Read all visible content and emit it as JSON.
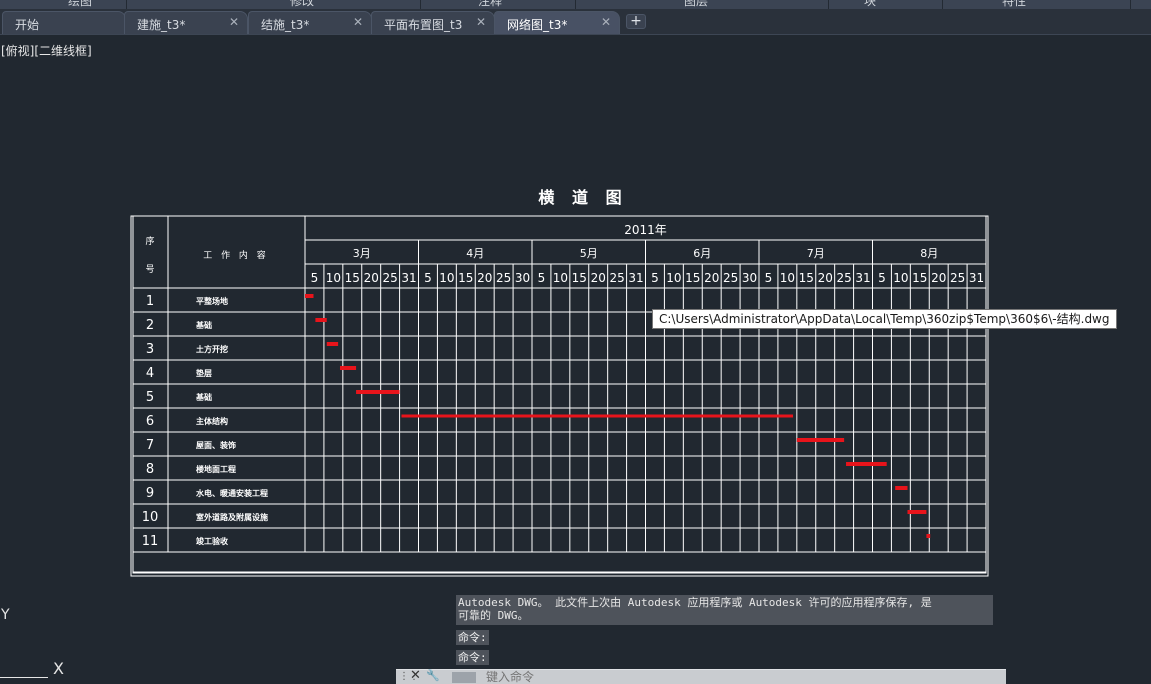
{
  "ribbon_panels": [
    "绘图",
    "修改",
    "注释",
    "图层",
    "块",
    "特性"
  ],
  "tabs": [
    {
      "label": "开始",
      "closable": false,
      "active": false
    },
    {
      "label": "建施_t3*",
      "closable": true,
      "active": false
    },
    {
      "label": "结施_t3*",
      "closable": true,
      "active": false
    },
    {
      "label": "平面布置图_t3",
      "closable": true,
      "active": false
    },
    {
      "label": "网络图_t3*",
      "closable": true,
      "active": true
    }
  ],
  "add_tab_icon": "+",
  "close_icon": "✕",
  "viewport_label": "[俯视][二维线框]",
  "drawing": {
    "title": "横 道 图",
    "year": "2011年",
    "header_seq": "序\n号",
    "header_name": "工 作 内 容",
    "months": [
      "3月",
      "4月",
      "5月",
      "6月",
      "7月",
      "8月"
    ],
    "days": [
      [
        "5",
        "10",
        "15",
        "20",
        "25",
        "31"
      ],
      [
        "5",
        "10",
        "15",
        "20",
        "25",
        "30"
      ],
      [
        "5",
        "10",
        "15",
        "20",
        "25",
        "31"
      ],
      [
        "5",
        "10",
        "15",
        "20",
        "25",
        "30"
      ],
      [
        "5",
        "10",
        "15",
        "20",
        "25",
        "31"
      ],
      [
        "5",
        "10",
        "15",
        "20",
        "25",
        "31"
      ]
    ],
    "line_color": "#ffffff",
    "bar_color": "#e8141b",
    "rows": [
      {
        "no": "1",
        "task": "平整场地",
        "start": 0,
        "end": 0.45
      },
      {
        "no": "2",
        "task": "基础",
        "start": 0.55,
        "end": 1.15
      },
      {
        "no": "3",
        "task": "土方开挖",
        "start": 1.15,
        "end": 1.75
      },
      {
        "no": "4",
        "task": "垫层",
        "start": 1.85,
        "end": 2.7
      },
      {
        "no": "5",
        "task": "基础",
        "start": 2.7,
        "end": 5.0
      },
      {
        "no": "6",
        "task": "主体结构",
        "start": 5.1,
        "end": 25.8
      },
      {
        "no": "7",
        "task": "屋面、装饰",
        "start": 26.0,
        "end": 28.5
      },
      {
        "no": "8",
        "task": "楼地面工程",
        "start": 28.6,
        "end": 30.75
      },
      {
        "no": "9",
        "task": "水电、暖通安装工程",
        "start": 31.2,
        "end": 31.85
      },
      {
        "no": "10",
        "task": "室外道路及附属设施",
        "start": 31.85,
        "end": 32.85
      },
      {
        "no": "11",
        "task": "竣工验收",
        "start": 32.85,
        "end": 33.05
      }
    ]
  },
  "tooltip": "C:\\Users\\Administrator\\AppData\\Local\\Temp\\360zip$Temp\\360$6\\-结构.dwg",
  "message_line1": "Autodesk DWG。  此文件上次由 Autodesk 应用程序或 Autodesk 许可的应用程序保存, 是",
  "message_line2": "可靠的 DWG。",
  "command_history": [
    "命令:",
    "命令:"
  ],
  "command_placeholder": "键入命令",
  "ucs": {
    "y_label": "Y",
    "x_label": "X"
  }
}
